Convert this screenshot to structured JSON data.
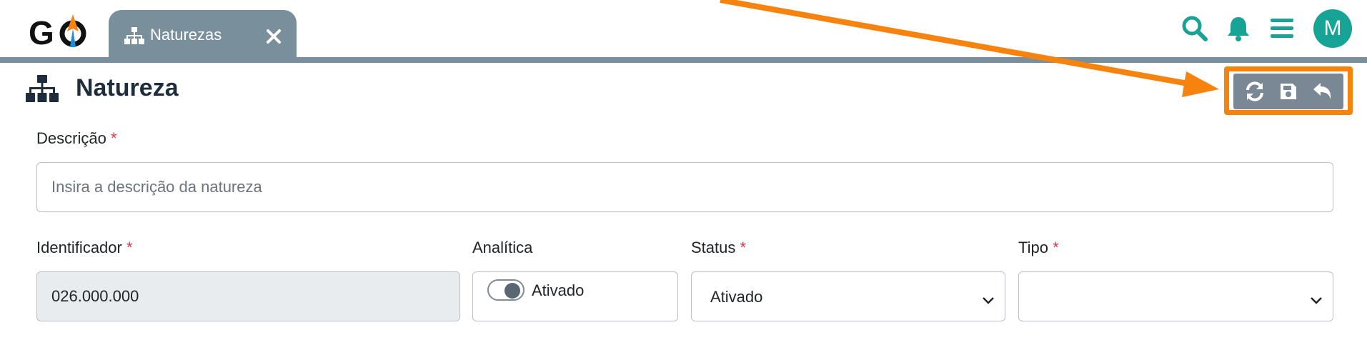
{
  "app": {
    "logo_text": "GO",
    "avatar_initial": "M"
  },
  "tab": {
    "label": "Naturezas",
    "icon": "sitemap-icon",
    "close_icon": "close-icon"
  },
  "top_icons": [
    "search-icon",
    "bell-icon",
    "menu-icon"
  ],
  "page": {
    "title": "Natureza",
    "icon": "sitemap-icon"
  },
  "toolbar": {
    "buttons": [
      "refresh-icon",
      "save-icon",
      "undo-icon"
    ],
    "highlight_color": "#f7830f"
  },
  "form": {
    "descricao": {
      "label": "Descrição",
      "required_mark": "*",
      "value": "",
      "placeholder": "Insira a descrição da natureza"
    },
    "identificador": {
      "label": "Identificador",
      "required_mark": "*",
      "value": "026.000.000"
    },
    "analitica": {
      "label": "Analítica",
      "switch_label": "Ativado",
      "checked": true
    },
    "status": {
      "label": "Status",
      "required_mark": "*",
      "value": "Ativado"
    },
    "tipo": {
      "label": "Tipo",
      "required_mark": "*",
      "value": ""
    }
  },
  "colors": {
    "accent": "#17a395",
    "tab_bg": "#7a8f9c",
    "title": "#1e2d3b",
    "required": "#dc3545",
    "arrow": "#f7830f"
  }
}
